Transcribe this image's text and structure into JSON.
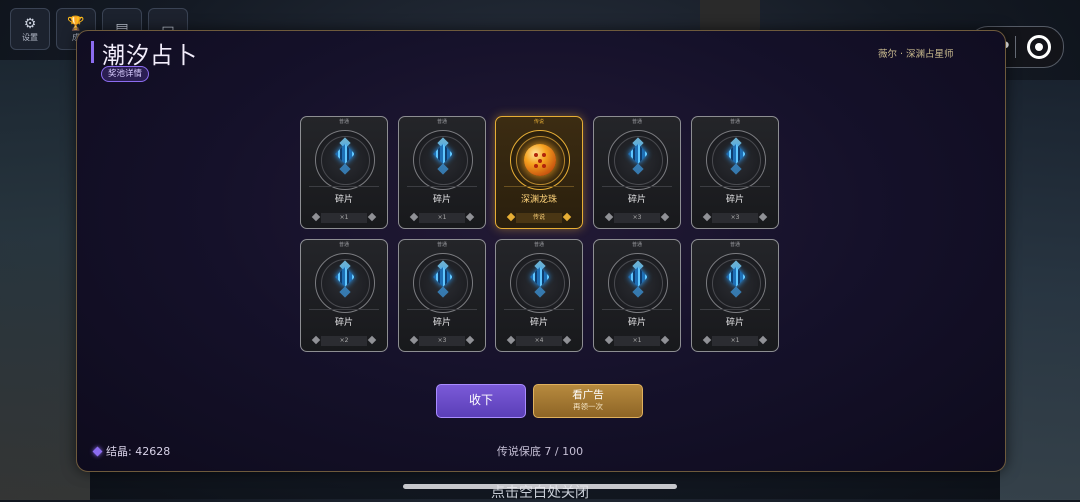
{
  "top_icons": [
    {
      "label": "设置",
      "icon": "gear-icon",
      "glyph": "⚙"
    },
    {
      "label": "成",
      "icon": "trophy-icon",
      "glyph": "🏆"
    },
    {
      "label": "",
      "icon": "book-icon",
      "glyph": "▤"
    },
    {
      "label": "",
      "icon": "ticket-icon",
      "glyph": "▭"
    }
  ],
  "capsule": {
    "more": "•••"
  },
  "panel": {
    "title": "潮汐占卜",
    "pool_detail": "奖池详情",
    "npc": "薇尔 · 深渊占星师"
  },
  "cards": [
    {
      "rarity": "普通",
      "name": "碎片",
      "count": "×1",
      "type": "shard"
    },
    {
      "rarity": "普通",
      "name": "碎片",
      "count": "×1",
      "type": "shard"
    },
    {
      "rarity": "传说",
      "name": "深渊龙珠",
      "count": "传说",
      "type": "legend"
    },
    {
      "rarity": "普通",
      "name": "碎片",
      "count": "×3",
      "type": "shard"
    },
    {
      "rarity": "普通",
      "name": "碎片",
      "count": "×3",
      "type": "shard"
    },
    {
      "rarity": "普通",
      "name": "碎片",
      "count": "×2",
      "type": "shard"
    },
    {
      "rarity": "普通",
      "name": "碎片",
      "count": "×3",
      "type": "shard"
    },
    {
      "rarity": "普通",
      "name": "碎片",
      "count": "×4",
      "type": "shard"
    },
    {
      "rarity": "普通",
      "name": "碎片",
      "count": "×1",
      "type": "shard"
    },
    {
      "rarity": "普通",
      "name": "碎片",
      "count": "×1",
      "type": "shard"
    }
  ],
  "buttons": {
    "collect": "收下",
    "ad_main": "看广告",
    "ad_sub": "再领一次"
  },
  "footer": {
    "crystal": "结晶: 42628",
    "pity": "传说保底 7 / 100"
  },
  "close_hint": "点击空白处关闭",
  "colors": {
    "accent_purple": "#8c6cf0",
    "legend_gold": "#e7ae35",
    "shard_blue": "#5ec6ff"
  }
}
